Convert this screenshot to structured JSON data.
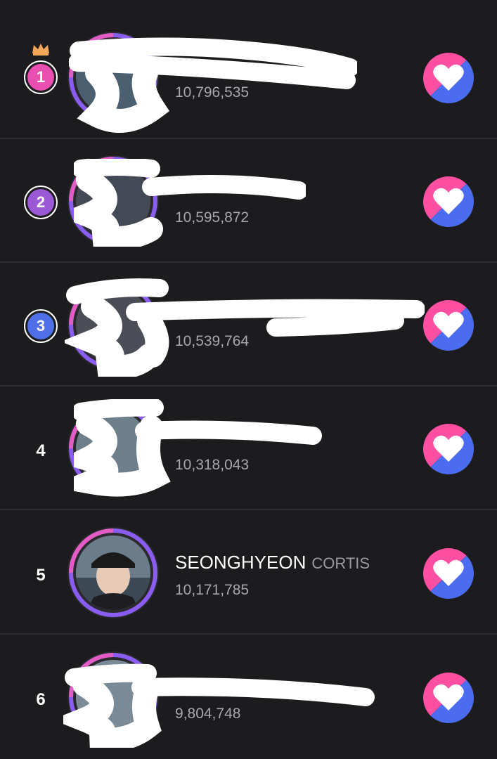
{
  "entries": [
    {
      "rank": "1",
      "name": "",
      "group": "",
      "votes": "10,796,535",
      "rank_color": "#e94fb0",
      "redacted": true
    },
    {
      "rank": "2",
      "name": "",
      "group": "",
      "votes": "10,595,872",
      "rank_color": "#9b59d6",
      "redacted": true
    },
    {
      "rank": "3",
      "name": "",
      "group": "",
      "votes": "10,539,764",
      "rank_color": "#4f6fe8",
      "redacted": true
    },
    {
      "rank": "4",
      "name": "",
      "group": "",
      "votes": "10,318,043",
      "redacted": true
    },
    {
      "rank": "5",
      "name": "SEONGHYEON",
      "group": "CORTIS",
      "votes": "10,171,785",
      "redacted": false
    },
    {
      "rank": "6",
      "name": "",
      "group": "",
      "votes": "9,804,748",
      "redacted": true
    }
  ],
  "colors": {
    "ring_pink": "#e35bc4",
    "ring_purple": "#8a5cf0",
    "heart_pink": "#ff4fa3",
    "heart_blue": "#4b6cf0",
    "crown": "#f2a65a"
  },
  "icons": {
    "vote": "heart-icon",
    "top_rank": "crown-icon"
  }
}
